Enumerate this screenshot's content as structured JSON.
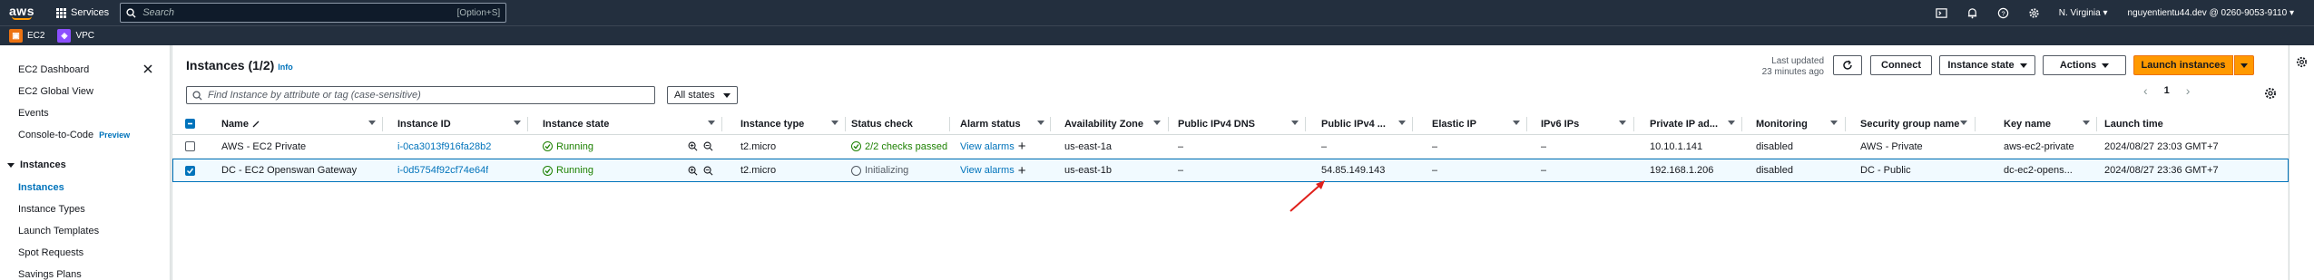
{
  "topnav": {
    "logo": "aws",
    "services_label": "Services",
    "search_placeholder": "Search",
    "search_hint": "[Option+S]",
    "region": "N. Virginia",
    "account": "nguyentientu44.dev @ 0260-9053-9110"
  },
  "favorites": [
    {
      "label": "EC2",
      "icon": "ec2-icon",
      "color": "#ec7211"
    },
    {
      "label": "VPC",
      "icon": "vpc-icon",
      "color": "#8c4fff"
    }
  ],
  "sidebar": {
    "items_top": [
      "EC2 Dashboard",
      "EC2 Global View",
      "Events",
      "Console-to-Code"
    ],
    "preview_badge": "Preview",
    "section": "Instances",
    "section_items": [
      "Instances",
      "Instance Types",
      "Launch Templates",
      "Spot Requests",
      "Savings Plans"
    ]
  },
  "panel": {
    "title": "Instances (1/2)",
    "info": "Info",
    "last_updated_line1": "Last updated",
    "last_updated_line2": "23 minutes ago",
    "connect_label": "Connect",
    "instance_state_label": "Instance state",
    "actions_label": "Actions",
    "launch_label": "Launch instances",
    "filter_placeholder": "Find Instance by attribute or tag (case-sensitive)",
    "states_label": "All states",
    "page": "1"
  },
  "table": {
    "columns": [
      "Name",
      "Instance ID",
      "Instance state",
      "Instance type",
      "Status check",
      "Alarm status",
      "Availability Zone",
      "Public IPv4 DNS",
      "Public IPv4 ...",
      "Elastic IP",
      "IPv6 IPs",
      "Private IP ad...",
      "Monitoring",
      "Security group name",
      "Key name",
      "Launch time"
    ],
    "rows": [
      {
        "selected": false,
        "name": "AWS - EC2 Private",
        "instance_id": "i-0ca3013f916fa28b2",
        "state": "Running",
        "type": "t2.micro",
        "status_check": "2/2 checks passed",
        "alarm": "View alarms",
        "az": "us-east-1a",
        "public_dns": "–",
        "public_ip": "–",
        "elastic_ip": "–",
        "ipv6": "–",
        "private_ip": "10.10.1.141",
        "monitoring": "disabled",
        "sg": "AWS - Private",
        "key": "aws-ec2-private",
        "launch": "2024/08/27 23:03 GMT+7"
      },
      {
        "selected": true,
        "name": "DC - EC2 Openswan Gateway",
        "instance_id": "i-0d5754f92cf74e64f",
        "state": "Running",
        "type": "t2.micro",
        "status_check": "Initializing",
        "alarm": "View alarms",
        "az": "us-east-1b",
        "public_dns": "–",
        "public_ip": "54.85.149.143",
        "elastic_ip": "–",
        "ipv6": "–",
        "private_ip": "192.168.1.206",
        "monitoring": "disabled",
        "sg": "DC - Public",
        "key": "dc-ec2-opens...",
        "launch": "2024/08/27 23:36 GMT+7"
      }
    ]
  },
  "colors": {
    "accent": "#ff9900",
    "link": "#0073bb",
    "running": "#1d8102",
    "annotation_arrow": "#e0201b"
  }
}
